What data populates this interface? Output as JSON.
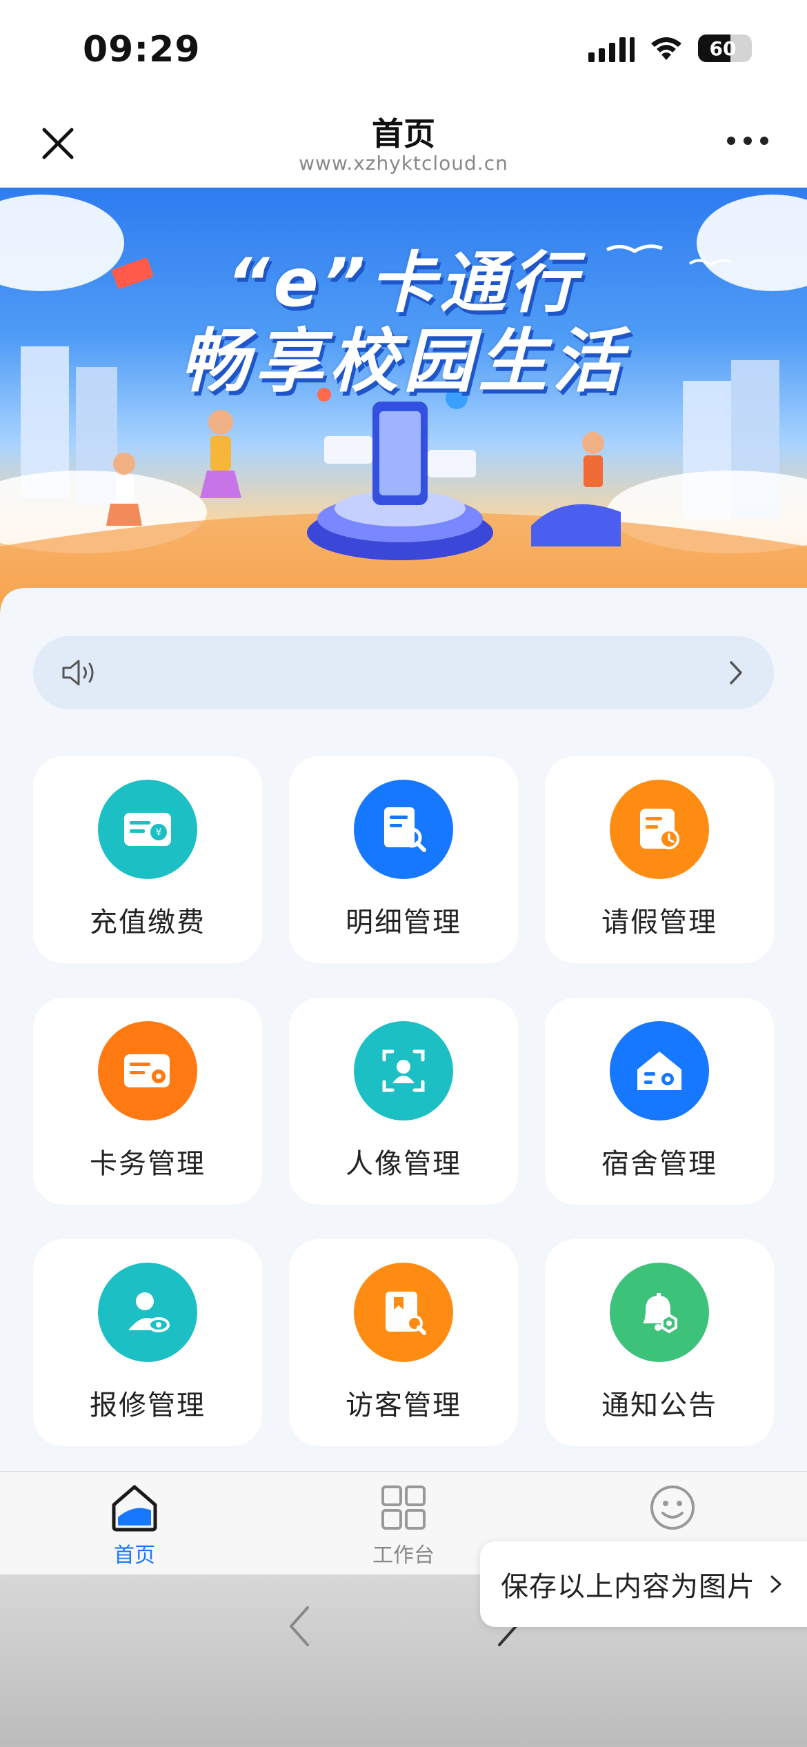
{
  "status_bar": {
    "time": "09:29",
    "battery": "60",
    "icons": [
      "signal-icon",
      "wifi-icon",
      "battery-icon"
    ]
  },
  "nav": {
    "title": "首页",
    "url": "www.xzhyktcloud.cn",
    "close_icon": "close-icon",
    "more_icon": "more-icon"
  },
  "banner": {
    "line1": "“e”卡通行",
    "line2": "畅享校园生活"
  },
  "notice": {
    "speaker_icon": "speaker-icon",
    "chevron_icon": "chevron-right-icon"
  },
  "tiles": [
    {
      "label": "充值缴费",
      "color": "#1bbfc4",
      "icon": "recharge-card-icon"
    },
    {
      "label": "明细管理",
      "color": "#1677ff",
      "icon": "document-search-icon"
    },
    {
      "label": "请假管理",
      "color": "#ff8c12",
      "icon": "document-clock-icon"
    },
    {
      "label": "卡务管理",
      "color": "#ff7a12",
      "icon": "card-settings-icon"
    },
    {
      "label": "人像管理",
      "color": "#1bbfc4",
      "icon": "face-scan-icon"
    },
    {
      "label": "宿舍管理",
      "color": "#1677ff",
      "icon": "dorm-settings-icon"
    },
    {
      "label": "报修管理",
      "color": "#1bbfc4",
      "icon": "repair-person-icon"
    },
    {
      "label": "访客管理",
      "color": "#ff8c12",
      "icon": "visitor-badge-icon"
    },
    {
      "label": "通知公告",
      "color": "#3dc27a",
      "icon": "notice-bell-icon"
    }
  ],
  "tab_bar": {
    "tabs": [
      {
        "label": "首页",
        "icon": "home-icon",
        "active": true
      },
      {
        "label": "工作台",
        "icon": "workbench-icon",
        "active": false
      },
      {
        "label": "",
        "icon": "smiley-icon",
        "active": false
      }
    ],
    "active_color": "#1677ff",
    "inactive_color": "#888888"
  },
  "save_tooltip": {
    "label": "保存以上内容为图片"
  }
}
